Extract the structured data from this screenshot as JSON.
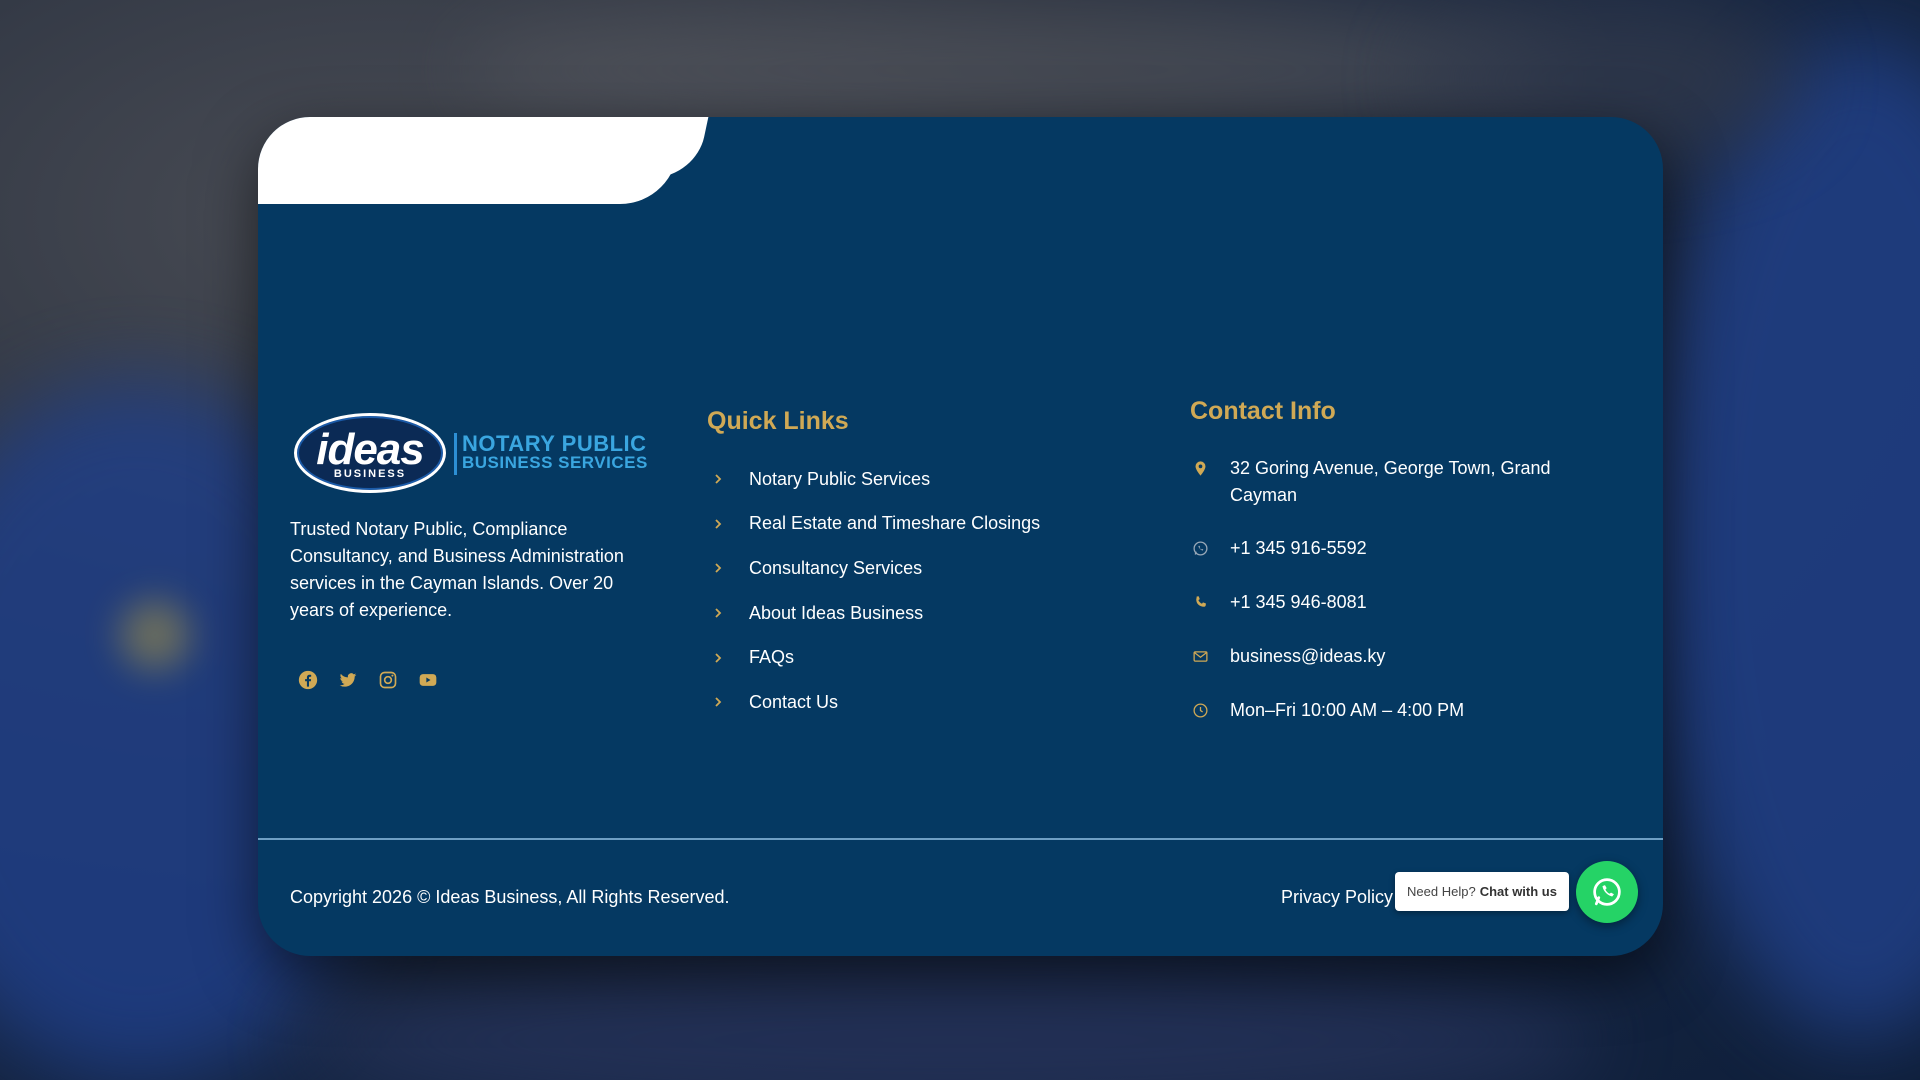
{
  "brand": {
    "logo_word": "ideas",
    "logo_sub": "BUSINESS",
    "tagline_line1": "NOTARY PUBLIC",
    "tagline_line2": "BUSINESS SERVICES",
    "description": "Trusted Notary Public, Compliance Consultancy, and Business Administration services in the Cayman Islands. Over 20 years of experience.",
    "socials": [
      "facebook-icon",
      "twitter-icon",
      "instagram-icon",
      "youtube-icon"
    ]
  },
  "quick_links": {
    "title": "Quick Links",
    "items": [
      {
        "label": "Notary Public Services"
      },
      {
        "label": "Real Estate and Timeshare Closings"
      },
      {
        "label": "Consultancy Services"
      },
      {
        "label": "About Ideas Business"
      },
      {
        "label": "FAQs"
      },
      {
        "label": "Contact Us"
      }
    ]
  },
  "contact": {
    "title": "Contact Info",
    "address": "32 Goring Avenue, George Town, Grand Cayman",
    "whatsapp": "+1 345 916-5592",
    "phone": "+1 345 946-8081",
    "email": "business@ideas.ky",
    "hours": "Mon–Fri 10:00 AM – 4:00 PM"
  },
  "footer": {
    "copyright": "Copyright 2026 © Ideas Business, All Rights Reserved.",
    "privacy": "Privacy Policy"
  },
  "chat_widget": {
    "prompt": "Need Help?",
    "action": "Chat with us"
  },
  "colors": {
    "background": "#053962",
    "accent": "#d0a955",
    "whatsapp": "#25d366"
  }
}
